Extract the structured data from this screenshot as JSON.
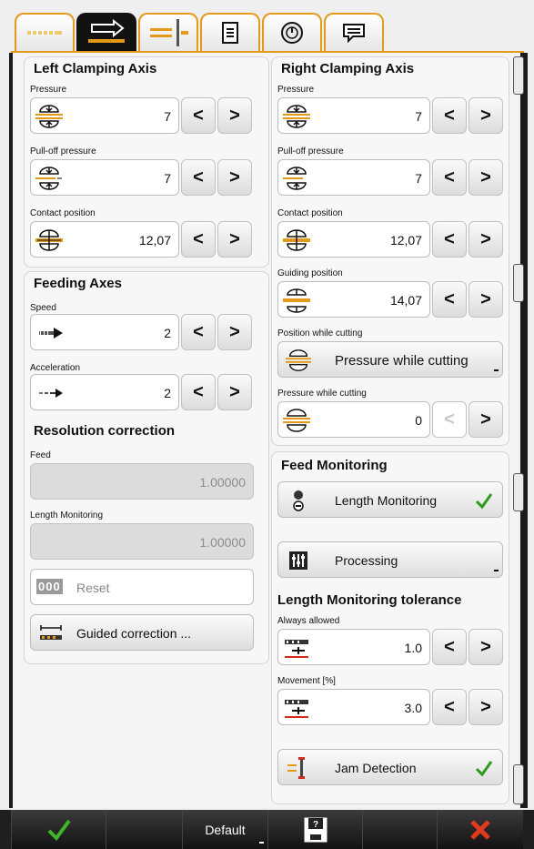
{
  "tabs": [
    {
      "icon": "clamp-positions-icon"
    },
    {
      "icon": "feed-arrow-icon",
      "active": true
    },
    {
      "icon": "axis-cut-icon"
    },
    {
      "icon": "document-list-icon"
    },
    {
      "icon": "dial-icon"
    },
    {
      "icon": "message-icon"
    }
  ],
  "left_clamping": {
    "title": "Left Clamping Axis",
    "pressure": {
      "label": "Pressure",
      "value": "7"
    },
    "pulloff": {
      "label": "Pull-off pressure",
      "value": "7"
    },
    "contact": {
      "label": "Contact position",
      "value": "12,07"
    }
  },
  "feeding": {
    "title": "Feeding Axes",
    "speed": {
      "label": "Speed",
      "value": "2"
    },
    "accel": {
      "label": "Acceleration",
      "value": "2"
    }
  },
  "resolution": {
    "title": "Resolution correction",
    "feed": {
      "label": "Feed",
      "value": "1.00000"
    },
    "length": {
      "label": "Length Monitoring",
      "value": "1.00000"
    },
    "reset_label": "Reset",
    "reset_icon_text": "000",
    "guided_label": "Guided correction ..."
  },
  "right_clamping": {
    "title": "Right Clamping Axis",
    "pressure": {
      "label": "Pressure",
      "value": "7"
    },
    "pulloff": {
      "label": "Pull-off pressure",
      "value": "7"
    },
    "contact": {
      "label": "Contact position",
      "value": "12,07"
    },
    "guiding": {
      "label": "Guiding position",
      "value": "14,07"
    },
    "cut_pos_label": "Position while cutting",
    "cut_pos_value": "Pressure while cutting",
    "cut_pressure": {
      "label": "Pressure while cutting",
      "value": "0"
    }
  },
  "feed_monitoring": {
    "title": "Feed Monitoring",
    "length_btn": "Length Monitoring",
    "processing_btn": "Processing",
    "tol_title": "Length Monitoring tolerance",
    "always": {
      "label": "Always allowed",
      "value": "1.0"
    },
    "movement": {
      "label": "Movement [%]",
      "value": "3.0"
    },
    "jam_btn": "Jam Detection"
  },
  "footer": {
    "default_label": "Default"
  },
  "colors": {
    "accent": "#e39a1a",
    "check": "#2f9a1f",
    "cancel": "#e23a1a"
  }
}
